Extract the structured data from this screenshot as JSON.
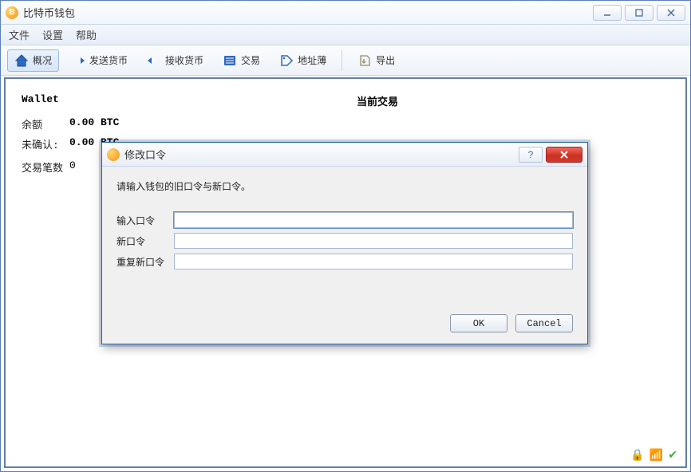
{
  "app": {
    "title": "比特币钱包"
  },
  "menu": {
    "file": "文件",
    "settings": "设置",
    "help": "帮助"
  },
  "toolbar": {
    "overview": "概况",
    "send": "发送货币",
    "receive": "接收货币",
    "tx": "交易",
    "addressbook": "地址薄",
    "export": "导出"
  },
  "wallet": {
    "heading": "Wallet",
    "balance_label": "余额",
    "balance_value": "0.00 BTC",
    "unconfirmed_label": "未确认:",
    "unconfirmed_value": "0.00 BTC",
    "tx_count_label": "交易笔数",
    "tx_count_value": "0"
  },
  "current_tx_heading": "当前交易",
  "dialog": {
    "title": "修改口令",
    "message": "请输入钱包的旧口令与新口令。",
    "old_label": "输入口令",
    "new_label": "新口令",
    "repeat_label": "重复新口令",
    "ok": "OK",
    "cancel": "Cancel"
  },
  "colors": {
    "accent": "#2d62a3",
    "toolbar_active": "#d6e5f9"
  }
}
